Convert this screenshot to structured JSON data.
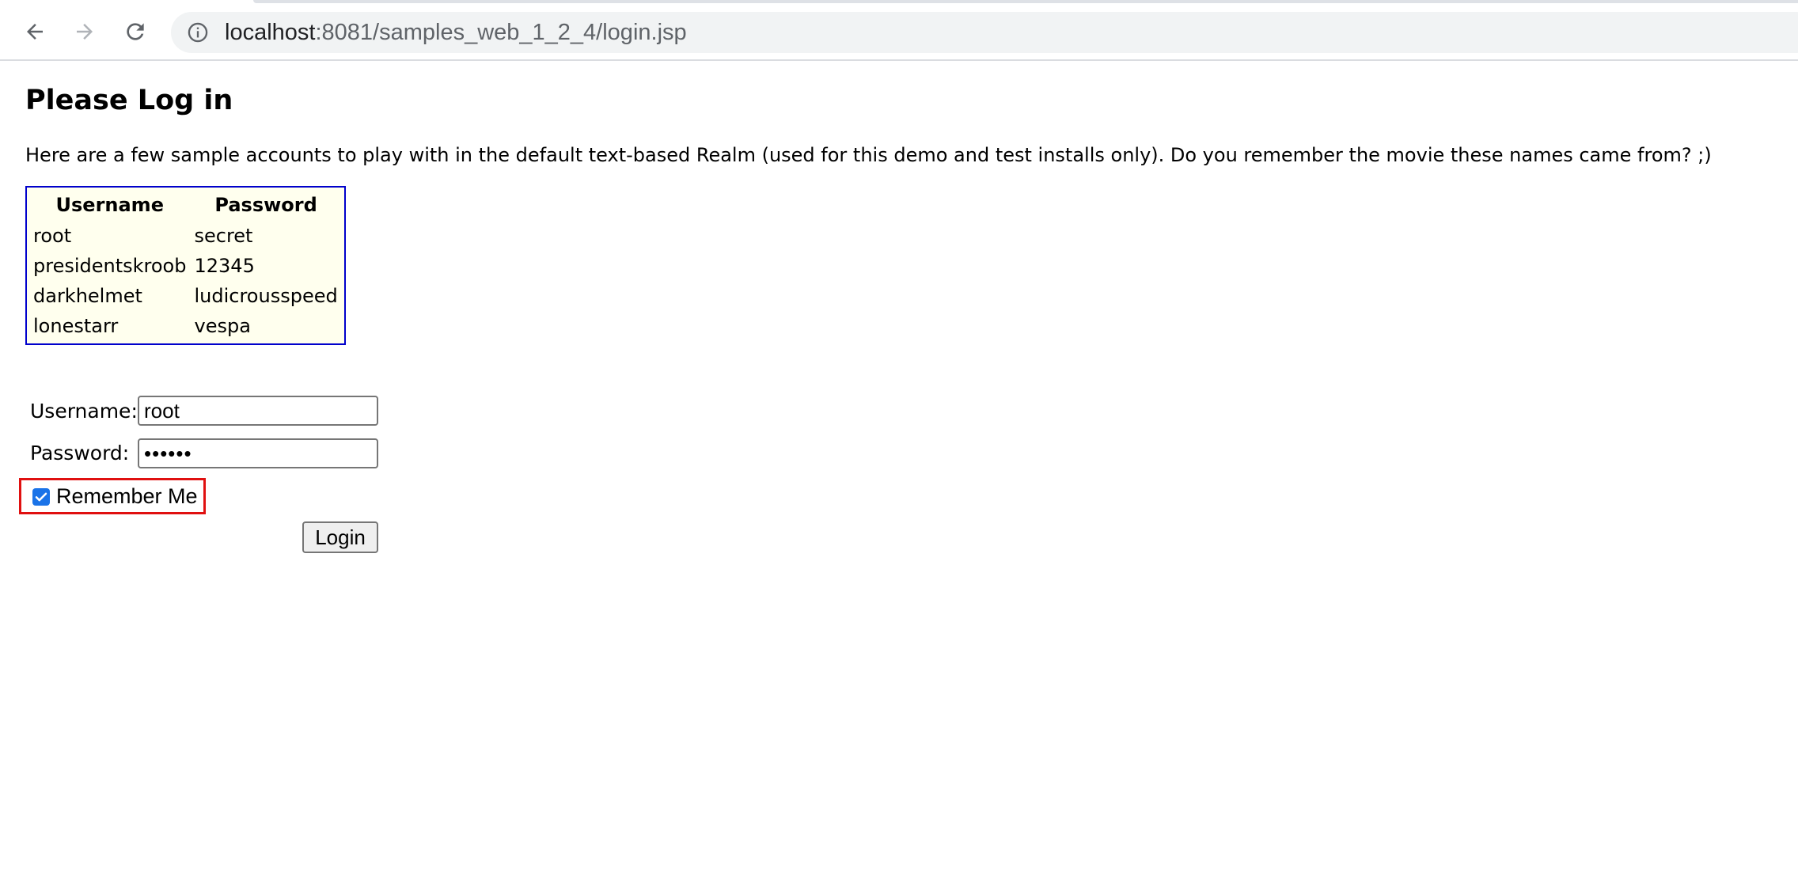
{
  "browser": {
    "url_host": "localhost",
    "url_rest": ":8081/samples_web_1_2_4/login.jsp",
    "icons": {
      "back": "arrow-left-icon",
      "forward": "arrow-right-icon",
      "reload": "reload-icon",
      "info": "info-icon"
    }
  },
  "page": {
    "title": "Please Log in",
    "intro": "Here are a few sample accounts to play with in the default text-based Realm (used for this demo and test installs only). Do you remember the movie these names came from? ;)",
    "accounts_table": {
      "headers": [
        "Username",
        "Password"
      ],
      "rows": [
        [
          "root",
          "secret"
        ],
        [
          "presidentskroob",
          "12345"
        ],
        [
          "darkhelmet",
          "ludicrousspeed"
        ],
        [
          "lonestarr",
          "vespa"
        ]
      ]
    },
    "form": {
      "username_label": "Username:",
      "username_value": "root",
      "password_label": "Password:",
      "password_value": "••••••",
      "remember_label": "Remember Me",
      "remember_checked": true,
      "submit_label": "Login"
    },
    "colors": {
      "table_border": "#0000cc",
      "table_bg": "#ffffee",
      "highlight": "#e01010",
      "checkbox": "#1a73e8"
    }
  }
}
